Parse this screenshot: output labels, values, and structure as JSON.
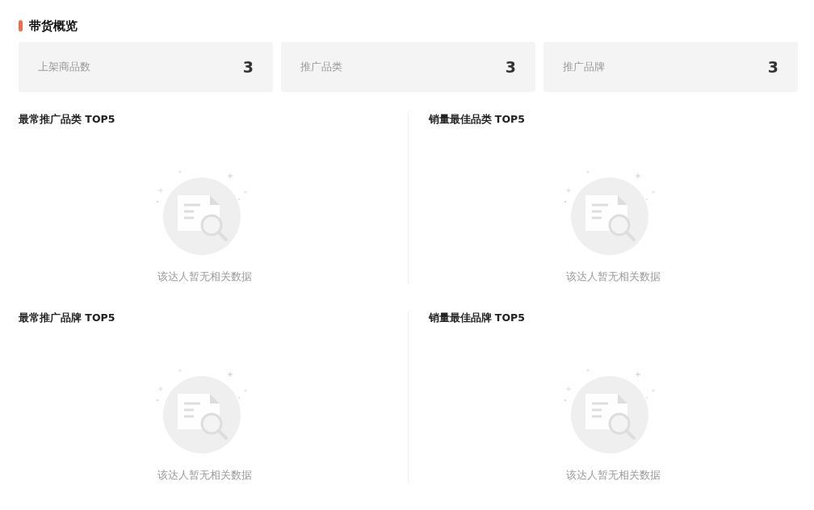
{
  "section": {
    "title": "带货概览"
  },
  "stats": [
    {
      "label": "上架商品数",
      "value": "3"
    },
    {
      "label": "推广品类",
      "value": "3"
    },
    {
      "label": "推广品牌",
      "value": "3"
    }
  ],
  "panels": [
    {
      "title": "最常推广品类 TOP5",
      "empty_text": "该达人暂无相关数据"
    },
    {
      "title": "销量最佳品类 TOP5",
      "empty_text": "该达人暂无相关数据"
    },
    {
      "title": "最常推广品牌 TOP5",
      "empty_text": "该达人暂无相关数据"
    },
    {
      "title": "销量最佳品牌 TOP5",
      "empty_text": "该达人暂无相关数据"
    }
  ]
}
